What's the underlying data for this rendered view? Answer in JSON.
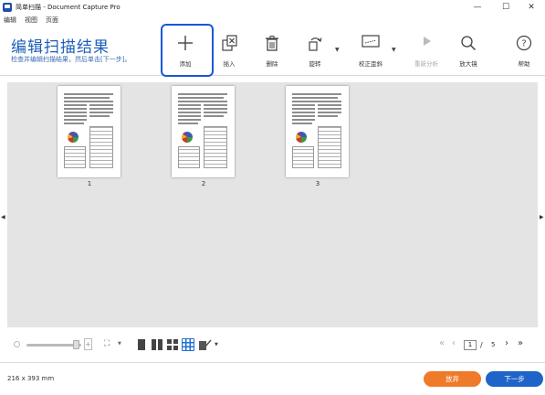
{
  "window": {
    "title": "简单扫描 - Document Capture Pro",
    "minimize": "—",
    "maximize": "☐",
    "close": "✕"
  },
  "menu": [
    "编辑",
    "视图",
    "页面"
  ],
  "header": {
    "title": "编辑扫描结果",
    "subtitle": "检查并编辑扫描结果，然后单击[下一步]。"
  },
  "toolbar": {
    "add": "添加",
    "insert": "插入",
    "delete": "删除",
    "rotate": "旋转",
    "deskew": "校正歪斜",
    "reanalyze": "重新分析",
    "magnifier": "放大镜",
    "help": "帮助"
  },
  "thumbnails": [
    {
      "number": "1"
    },
    {
      "number": "2"
    },
    {
      "number": "3"
    }
  ],
  "pagination": {
    "current": "1",
    "separator": "/",
    "total": "5"
  },
  "footer": {
    "dimensions": "216 x 393 mm",
    "cancel": "放弃",
    "next": "下一步"
  },
  "colors": {
    "accent_blue": "#1f64c8",
    "cancel_orange": "#ef7a2a",
    "title_blue": "#1d5fb8",
    "selected_view": "#1e6fd0"
  }
}
